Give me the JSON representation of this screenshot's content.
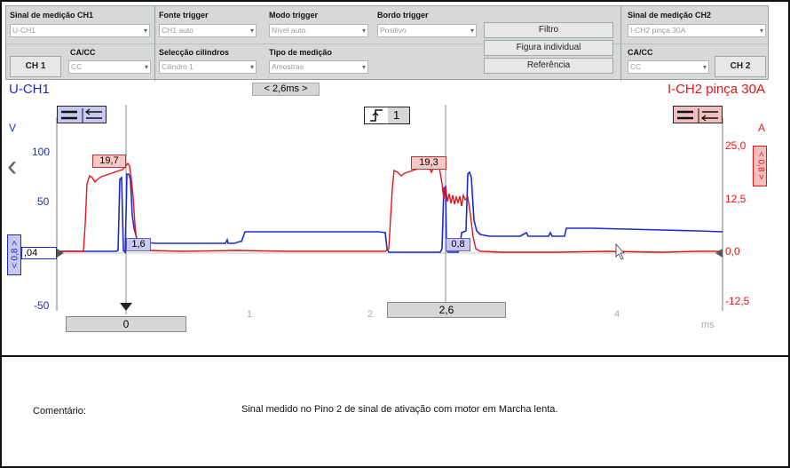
{
  "controls": {
    "ch1_signal_label": "Sinal de medição CH1",
    "ch1_signal_value": "U-CH1",
    "ch1_coupling_label": "CA/CC",
    "ch1_coupling_value": "CC",
    "ch1_button": "CH 1",
    "trigger_source_label": "Fonte trigger",
    "trigger_source_value": "CH1 auto",
    "cylinder_select_label": "Selecção cilindros",
    "cylinder_select_value": "Cilindro 1",
    "trigger_mode_label": "Modo trigger",
    "trigger_mode_value": "Nível auto.",
    "measure_type_label": "Tipo de medição",
    "measure_type_value": "Amostras",
    "trigger_edge_label": "Bordo trigger",
    "trigger_edge_value": "Positivo",
    "filter_button": "Filtro",
    "single_figure_button": "Figura individual",
    "reference_button": "Referência",
    "ch2_signal_label": "Sinal de medição CH2",
    "ch2_signal_value": "I-CH2 pinça 30A",
    "ch2_coupling_label": "CA/CC",
    "ch2_coupling_value": "CC",
    "ch2_button": "CH 2"
  },
  "scope": {
    "ch1_title": "U-CH1",
    "ch2_title": "I-CH2 pinça 30A",
    "timebase": "< 2,6ms >",
    "ch1_unit": "V",
    "ch2_unit": "A",
    "y_left_ticks": [
      "100",
      "50",
      "-50"
    ],
    "y_right_ticks": [
      "25,0",
      "12,5",
      "0,0",
      "-12,5"
    ],
    "x_ticks": [
      "1",
      "2",
      "4"
    ],
    "x_unit": "ms",
    "trigger_channel": "1",
    "ch1_offset": ",04",
    "ch1_scale": "< 0,8 >",
    "ch2_scale": "< 0,8 >",
    "marker1_peak": "19,7",
    "marker1_low": "1,6",
    "marker2_peak": "19,3",
    "marker2_low": "0,8",
    "cursor1_time": "0",
    "cursor2_time": "2,6",
    "colors": {
      "ch1": "#1a2ad0",
      "ch2": "#e51515"
    }
  },
  "comment": {
    "label": "Comentário:",
    "text": "Sinal medido no Pino 2 de sinal de ativação com motor em Marcha lenta."
  }
}
